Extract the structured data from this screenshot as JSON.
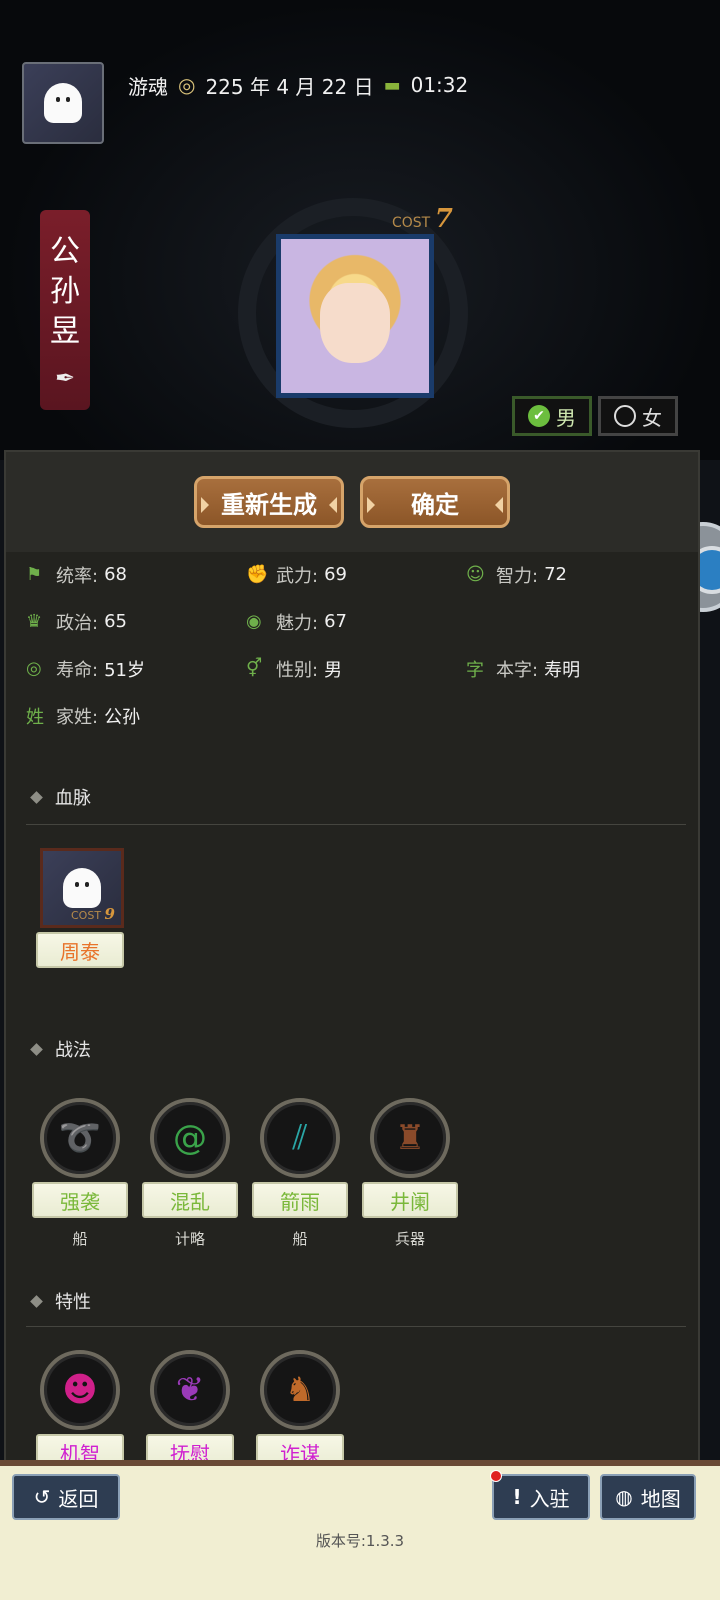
{
  "header": {
    "player_name": "游魂",
    "date": "225 年 4 月 22 日",
    "time": "01:32",
    "calendar_icon": "calendar-icon",
    "clock_icon": "clock-icon"
  },
  "character": {
    "name_chars": [
      "公",
      "孙",
      "昱"
    ],
    "cost_label": "COST",
    "cost_value": "7",
    "gender_options": [
      {
        "label": "男",
        "selected": true
      },
      {
        "label": "女",
        "selected": false
      }
    ]
  },
  "actions": {
    "regenerate": "重新生成",
    "confirm": "确定"
  },
  "stats": [
    {
      "label": "统率:",
      "value": "68",
      "icon": "flag-icon"
    },
    {
      "label": "武力:",
      "value": "69",
      "icon": "arm-icon"
    },
    {
      "label": "智力:",
      "value": "72",
      "icon": "brain-icon"
    },
    {
      "label": "政治:",
      "value": "65",
      "icon": "politics-icon"
    },
    {
      "label": "魅力:",
      "value": "67",
      "icon": "eye-icon"
    },
    {
      "label": "寿命:",
      "value": "51岁",
      "icon": "lifespan-icon"
    },
    {
      "label": "性别:",
      "value": "男",
      "icon": "gender-icon"
    },
    {
      "label": "本字:",
      "value": "寿明",
      "icon_text": "字"
    },
    {
      "label": "家姓:",
      "value": "公孙",
      "icon_text": "姓"
    }
  ],
  "bloodline": {
    "title": "血脉",
    "card": {
      "name": "周泰",
      "cost_label": "COST",
      "cost_value": "9"
    }
  },
  "tactics": {
    "title": "战法",
    "items": [
      {
        "name": "强袭",
        "type": "船",
        "color": "#7ab83a"
      },
      {
        "name": "混乱",
        "type": "计略",
        "color": "#7ab83a"
      },
      {
        "name": "箭雨",
        "type": "船",
        "color": "#7ab83a"
      },
      {
        "name": "井阑",
        "type": "兵器",
        "color": "#7ab83a"
      }
    ]
  },
  "traits": {
    "title": "特性",
    "items": [
      {
        "name": "机智",
        "color": "#d020d0"
      },
      {
        "name": "抚慰",
        "color": "#d020d0"
      },
      {
        "name": "诈谋",
        "color": "#d020d0"
      }
    ]
  },
  "footer": {
    "back": "返回",
    "station": "入驻",
    "map": "地图",
    "version": "版本号:1.3.3"
  }
}
